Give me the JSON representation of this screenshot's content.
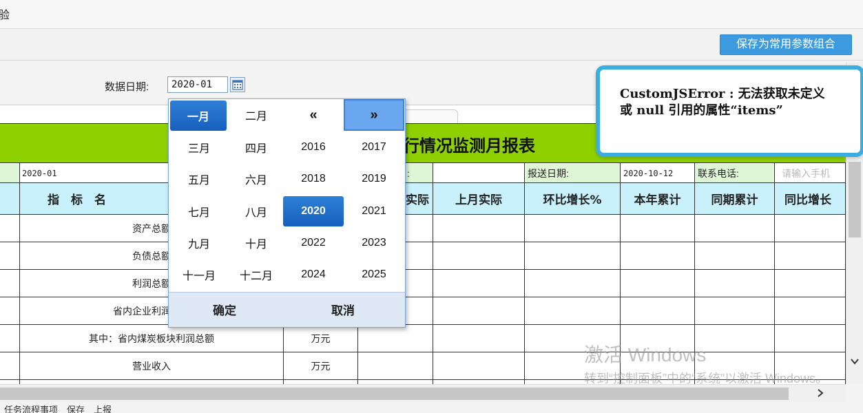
{
  "window": {
    "title": "验"
  },
  "toolbar": {
    "save_combo_label": "保存为常用参数组合"
  },
  "filter": {
    "date_label": "数据日期:",
    "date_value": "2020-01"
  },
  "report": {
    "title": "行情况监测月报表",
    "info_row": {
      "date_value": "2020-01",
      "col_label_partial": ":",
      "report_date_label": "报送日期:",
      "report_date_value": "2020-10-12",
      "phone_label": "联系电话:",
      "phone_placeholder": "请输入手机"
    },
    "header": {
      "indicator": "指　标　名",
      "partial_actual": "实际",
      "last_month_actual": "上月实际",
      "mom_growth": "环比增长%",
      "ytd": "本年累计",
      "same_period_ytd": "同期累计",
      "yoy_growth": "同比增长"
    },
    "rows": [
      {
        "name": "资产总额",
        "unit": ""
      },
      {
        "name": "负债总额",
        "unit": ""
      },
      {
        "name": "利润总额",
        "unit": ""
      },
      {
        "name": "省内企业利润总额",
        "unit": ""
      },
      {
        "name": "其中：省内煤炭板块利润总额",
        "unit": "万元"
      },
      {
        "name": "营业收入",
        "unit": "万元"
      }
    ]
  },
  "picker": {
    "months": [
      "一月",
      "二月",
      "三月",
      "四月",
      "五月",
      "六月",
      "七月",
      "八月",
      "九月",
      "十月",
      "十一月",
      "十二月"
    ],
    "prev_label": "«",
    "next_label": "»",
    "years": [
      "2016",
      "2017",
      "2018",
      "2019",
      "2020",
      "2021",
      "2022",
      "2023",
      "2024",
      "2025"
    ],
    "selected_month": "一月",
    "selected_year": "2020",
    "ok_label": "确定",
    "cancel_label": "取消"
  },
  "error": {
    "message": "CustomJSError : 无法获取未定义或 null 引用的属性“items”"
  },
  "watermark": {
    "line1": "激活 Windows",
    "line2": "转到“控制面板”中的“系统”以激活 Windows。"
  },
  "status": {
    "text": "任务流程事项　保存　上报"
  },
  "icons": {
    "calendar": "calendar-icon",
    "chevron_down": "chevron-down-icon",
    "chevron_right": "chevron-right-icon"
  }
}
